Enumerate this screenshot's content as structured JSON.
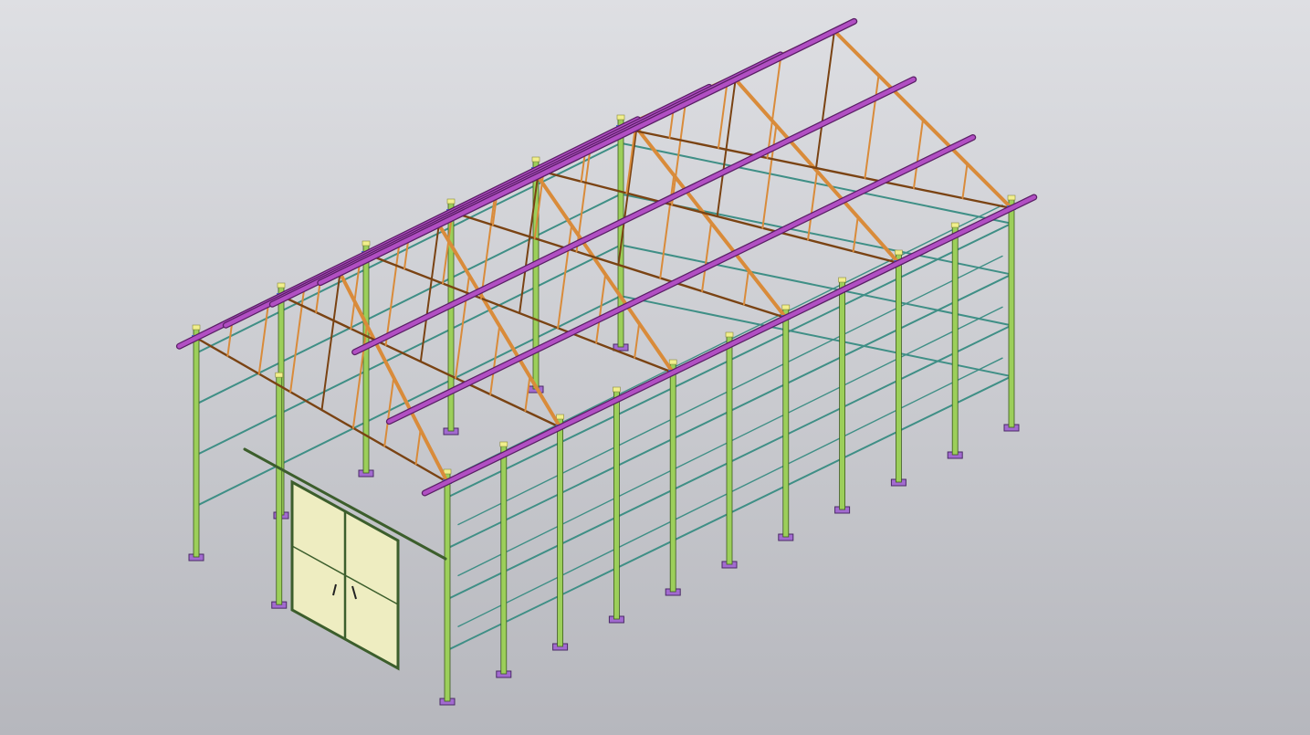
{
  "viewport": {
    "label": "",
    "background_top": "#dedfe3",
    "background_bottom": "#b6b7bd"
  },
  "model": {
    "description_visible": false,
    "colors": {
      "column": "#9ccf5a",
      "column_edge": "#3d5a1e",
      "girt": "#3f8f86",
      "purlin": "#b14fc3",
      "purlin_edge": "#5a1f66",
      "truss": "#d98b3a",
      "truss_edge": "#7a4313",
      "base_plate": "#a26ad0",
      "cap": "#f1ef8c",
      "door_panel": "#eeedc1",
      "door_frame": "#3c5e2c",
      "bracket": "#4a6fd6"
    },
    "bays_along_length": 5,
    "girt_levels": 4,
    "door": {
      "leaves": 2,
      "icon_names": [
        "door-handle-left-icon",
        "door-handle-right-icon"
      ]
    }
  }
}
